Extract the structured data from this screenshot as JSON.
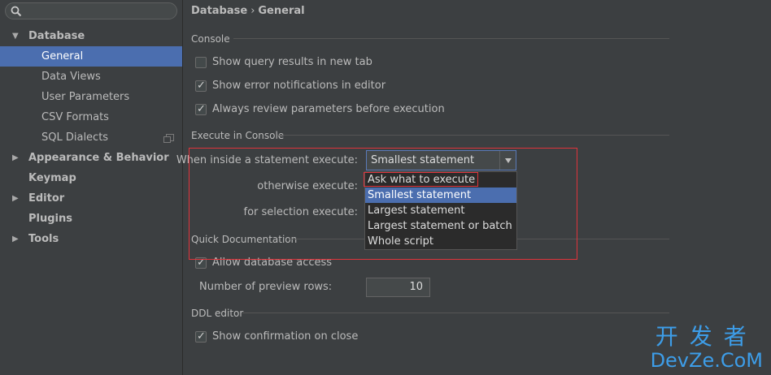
{
  "sidebar": {
    "search": {
      "value": "",
      "placeholder": ""
    },
    "items": [
      {
        "label": "Database",
        "level": 0,
        "expanded": true
      },
      {
        "label": "General",
        "level": 1,
        "selected": true
      },
      {
        "label": "Data Views",
        "level": 1
      },
      {
        "label": "User Parameters",
        "level": 1
      },
      {
        "label": "CSV Formats",
        "level": 1
      },
      {
        "label": "SQL Dialects",
        "level": 1
      },
      {
        "label": "Appearance & Behavior",
        "level": 0,
        "expanded": false
      },
      {
        "label": "Keymap",
        "level": 0
      },
      {
        "label": "Editor",
        "level": 0,
        "expanded": false
      },
      {
        "label": "Plugins",
        "level": 0
      },
      {
        "label": "Tools",
        "level": 0,
        "expanded": false
      }
    ]
  },
  "breadcrumb": {
    "parent": "Database",
    "separator": "›",
    "current": "General"
  },
  "console": {
    "title": "Console",
    "show_query_results": {
      "label": "Show query results in new tab",
      "checked": false
    },
    "show_error_notifications": {
      "label": "Show error notifications in editor",
      "checked": true
    },
    "always_review_params": {
      "label": "Always review parameters before execution",
      "checked": true
    }
  },
  "execute": {
    "title": "Execute in Console",
    "inside_label": "When inside a statement execute:",
    "inside_value": "Smallest statement",
    "otherwise_label": "otherwise execute:",
    "selection_label": "for selection execute:",
    "options": [
      "Ask what to execute",
      "Smallest statement",
      "Largest statement",
      "Largest statement or batch",
      "Whole script"
    ],
    "highlighted_option": "Smallest statement"
  },
  "quick_doc": {
    "title": "Quick Documentation",
    "allow_db_access": {
      "label": "Allow database access",
      "checked": true
    },
    "preview_rows_label": "Number of preview rows:",
    "preview_rows_value": "10"
  },
  "ddl": {
    "title": "DDL editor",
    "show_confirmation": {
      "label": "Show confirmation on close",
      "checked": true
    }
  },
  "watermark": {
    "cn": "开发者",
    "en": "DevZe.CoM"
  },
  "colors": {
    "selection": "#4b6eaf",
    "background": "#3c3f41",
    "highlight_outline": "#e0333b",
    "watermark": "#3d9de8"
  }
}
